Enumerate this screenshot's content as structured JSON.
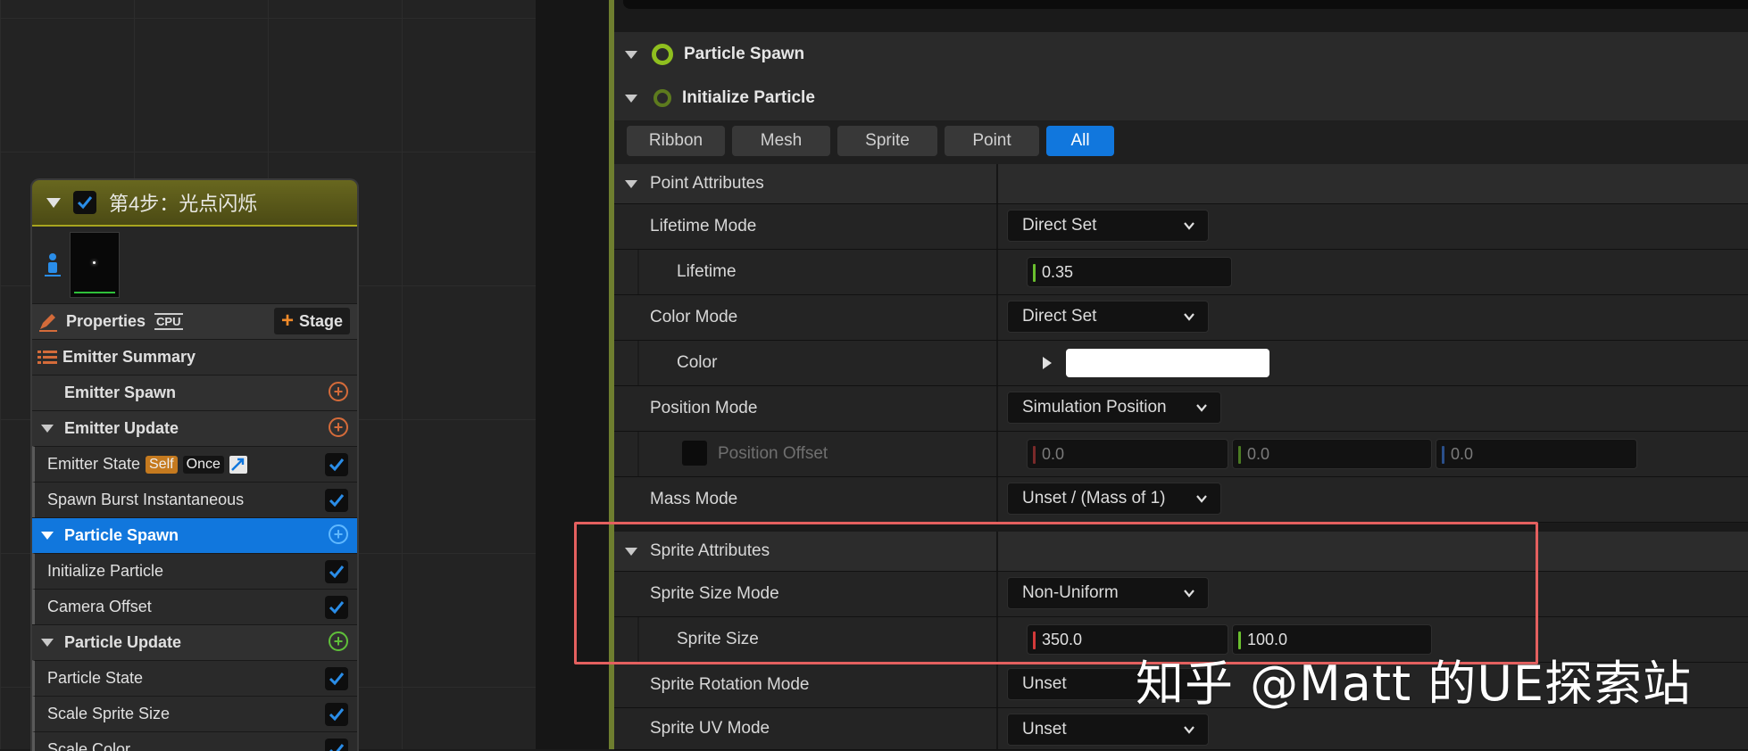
{
  "emitter": {
    "title": "第4步：光点闪烁",
    "properties_label": "Properties",
    "cpu_label": "CPU",
    "stage_label": "Stage",
    "rows": [
      {
        "label": "Emitter Summary",
        "kind": "summary"
      },
      {
        "label": "Emitter Spawn",
        "kind": "section",
        "plus_color": "#d46b3a"
      },
      {
        "label": "Emitter Update",
        "kind": "section",
        "plus_color": "#d46b3a"
      },
      {
        "label": "Emitter State",
        "kind": "item",
        "badges": [
          "Self",
          "Once"
        ]
      },
      {
        "label": "Spawn Burst Instantaneous",
        "kind": "item"
      },
      {
        "label": "Particle Spawn",
        "kind": "section",
        "selected": true,
        "plus_color": "#5fb8ff"
      },
      {
        "label": "Initialize Particle",
        "kind": "item"
      },
      {
        "label": "Camera Offset",
        "kind": "item"
      },
      {
        "label": "Particle Update",
        "kind": "section",
        "plus_color": "#5fbf3a"
      },
      {
        "label": "Particle State",
        "kind": "item"
      },
      {
        "label": "Scale Sprite Size",
        "kind": "item"
      },
      {
        "label": "Scale Color",
        "kind": "item"
      }
    ]
  },
  "panel": {
    "groups": [
      "Particle Spawn",
      "Initialize Particle"
    ],
    "tabs": [
      "Ribbon",
      "Mesh",
      "Sprite",
      "Point",
      "All"
    ],
    "active_tab": "All",
    "point_attributes": {
      "title": "Point Attributes",
      "lifetime_mode_label": "Lifetime Mode",
      "lifetime_mode_value": "Direct Set",
      "lifetime_label": "Lifetime",
      "lifetime_value": "0.35",
      "color_mode_label": "Color Mode",
      "color_mode_value": "Direct Set",
      "color_label": "Color",
      "color_value": "#ffffff",
      "position_mode_label": "Position Mode",
      "position_mode_value": "Simulation Position",
      "position_offset_label": "Position Offset",
      "position_offset": [
        "0.0",
        "0.0",
        "0.0"
      ],
      "mass_mode_label": "Mass Mode",
      "mass_mode_value": "Unset / (Mass of 1)"
    },
    "sprite_attributes": {
      "title": "Sprite Attributes",
      "size_mode_label": "Sprite Size Mode",
      "size_mode_value": "Non-Uniform",
      "size_label": "Sprite Size",
      "size_x": "350.0",
      "size_y": "100.0",
      "rotation_mode_label": "Sprite Rotation Mode",
      "rotation_mode_value": "Unset",
      "uv_mode_label": "Sprite UV Mode",
      "uv_mode_value": "Unset"
    }
  },
  "watermark": "知乎 @Matt 的UE探索站",
  "colors": {
    "accent_blue": "#1177dd",
    "highlight_red": "#e4605f",
    "x_axis": "#d33a3a",
    "y_axis": "#6abf2f",
    "z_axis": "#3a7ad6"
  }
}
